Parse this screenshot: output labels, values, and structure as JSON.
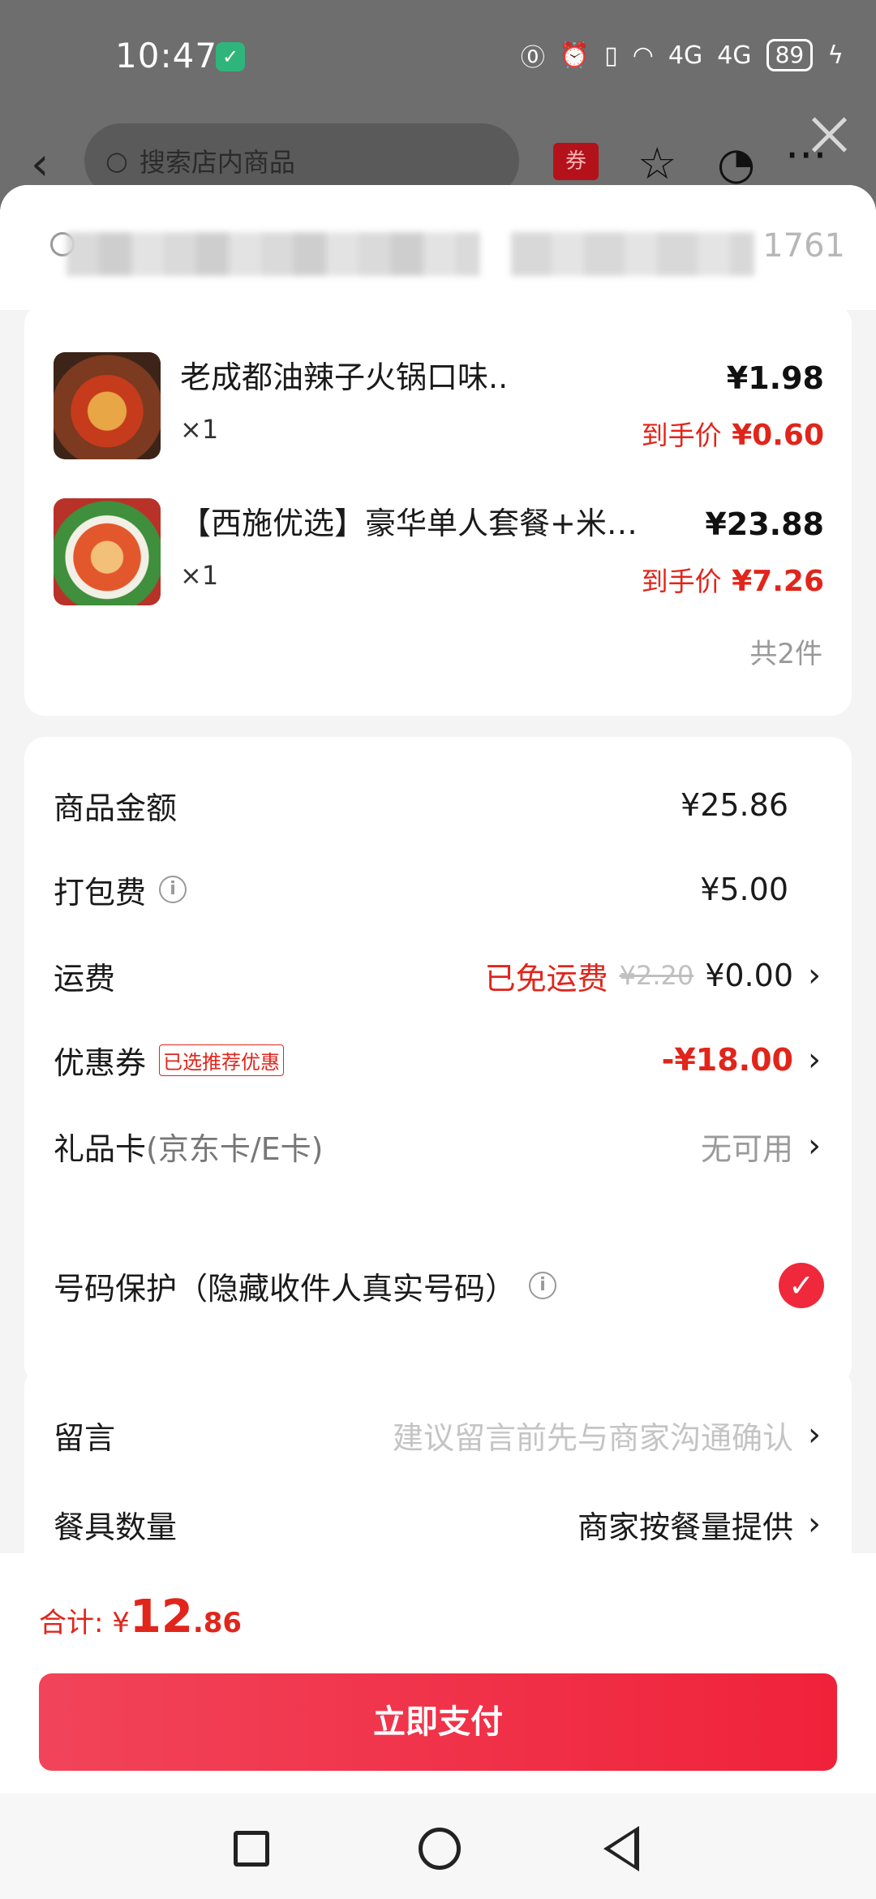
{
  "status_bar": {
    "time": "10:47",
    "battery": "89",
    "signal1": "4G",
    "signal2": "4G"
  },
  "top_nav": {
    "search_placeholder": "搜索店内商品",
    "coupon_label": "券"
  },
  "address": {
    "tail": "1761"
  },
  "items": [
    {
      "name": "老成都油辣子火锅口味..",
      "qty": "×1",
      "price": "¥1.98",
      "final_label": "到手价",
      "final_price": "¥0.60"
    },
    {
      "name": "【西施优选】豪华单人套餐+米…",
      "qty": "×1",
      "price": "¥23.88",
      "final_label": "到手价",
      "final_price": "¥7.26"
    }
  ],
  "item_count": "共2件",
  "fees": {
    "goods_label": "商品金额",
    "goods_value": "¥25.86",
    "pack_label": "打包费",
    "pack_value": "¥5.00",
    "ship_label": "运费",
    "ship_free": "已免运费",
    "ship_old": "¥2.20",
    "ship_value": "¥0.00",
    "coupon_label": "优惠券",
    "coupon_tag": "已选推荐优惠",
    "coupon_value": "-¥18.00",
    "gift_label": "礼品卡",
    "gift_sub": "(京东卡/E卡)",
    "gift_value": "无可用"
  },
  "privacy": {
    "label": "号码保护（隐藏收件人真实号码）",
    "checked": true
  },
  "extras": {
    "note_label": "留言",
    "note_placeholder": "建议留言前先与商家沟通确认",
    "tableware_label": "餐具数量",
    "tableware_value": "商家按餐量提供"
  },
  "footer": {
    "sum_label": "合计:",
    "currency": "¥",
    "sum_int": "12",
    "sum_cents": ".86",
    "pay_button": "立即支付"
  },
  "colors": {
    "accent": "#e1251b",
    "pay_button": "#f0283c"
  }
}
